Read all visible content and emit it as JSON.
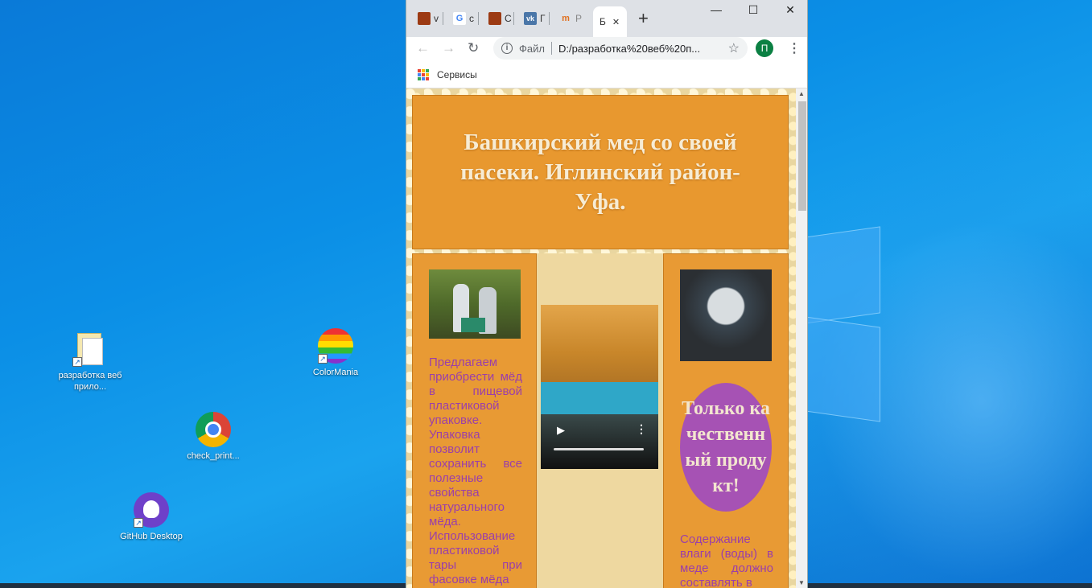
{
  "desktop": {
    "icons": [
      {
        "label": "разработка веб прило..."
      },
      {
        "label": "ColorMania"
      },
      {
        "label": "check_print..."
      },
      {
        "label": "GitHub Desktop"
      }
    ]
  },
  "browser": {
    "tabs": [
      {
        "label": "v"
      },
      {
        "label": "c"
      },
      {
        "label": "C"
      },
      {
        "label": "Г"
      },
      {
        "label": "P"
      },
      {
        "label": "Б"
      }
    ],
    "new_tab": "+",
    "window_controls": {
      "minimize": "—",
      "maximize": "☐",
      "close": "✕"
    },
    "tab_close": "✕",
    "address": {
      "scheme": "Файл",
      "url": "D:/разработка%20веб%20п..."
    },
    "profile_initial": "П",
    "bookmarks_label": "Сервисы"
  },
  "page": {
    "hero_title": "Башкирский мед со своей пасеки. Иглинский район-Уфа.",
    "left_text": "Предлагаем приобрести мёд в пищевой пластиковой упаковке. Упаковка позволит сохранить все полезные свойства натурального мёда. Использование пластиковой тары при фасовке мёда",
    "badge_text": "Только качественный продукт!",
    "right_text": "Содержание влаги (воды) в меде должно составлять в"
  },
  "colors": {
    "hero_bg": "#e8982f",
    "text_purple": "#9b3fa8",
    "badge_bg": "#a652b4",
    "hero_text": "#f7ecd4"
  }
}
